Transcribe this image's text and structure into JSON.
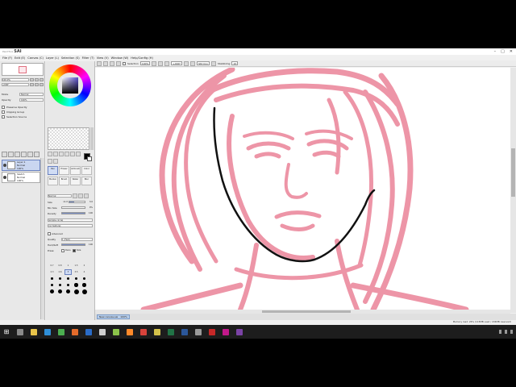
{
  "window": {
    "logo_small": "PaintTool",
    "logo": "SAI",
    "controls": [
      "–",
      "□",
      "✕"
    ]
  },
  "menu": [
    "File (F)",
    "Edit (E)",
    "Canvas (C)",
    "Layer (L)",
    "Selection (S)",
    "Filter (T)",
    "View (V)",
    "Window (W)",
    "Help/Config (H)"
  ],
  "toolbar": {
    "selection_label": "Selection",
    "zoom": "100%",
    "angle": "+000°",
    "stabilizer_label": "Stabilizing",
    "stabilizer_value": "10",
    "mode_label": "Std Cnv"
  },
  "navigator": {
    "zoom": "100.0%",
    "angle": "+000°"
  },
  "layer_props": {
    "opacity_label": "Opacity",
    "opacity_value": "100%",
    "blend_label": "Mode",
    "blend_value": "Normal",
    "preserve_label": "Preserve Opacity",
    "clip_label": "Clipping Group",
    "selection_source_label": "Selection Source"
  },
  "layers": [
    {
      "name": "Layer 1",
      "mode": "Normal",
      "opacity": "100%",
      "selected": true
    },
    {
      "name": "Sketch",
      "mode": "Normal",
      "opacity": "100%",
      "selected": false
    }
  ],
  "brush_tools": [
    {
      "label": "Pen",
      "selected": true
    },
    {
      "label": "Eraser",
      "selected": false
    },
    {
      "label": "Airbrush",
      "selected": false
    },
    {
      "label": "Color",
      "selected": false
    },
    {
      "label": "Marker",
      "selected": false
    },
    {
      "label": "Brush",
      "selected": false
    },
    {
      "label": "Water",
      "selected": false
    },
    {
      "label": "Blur",
      "selected": false
    }
  ],
  "brush_options": {
    "mode_label": "Normal",
    "size_label": "Size",
    "size_multiplier": "x1.0",
    "size_value": "3.0",
    "size_fraction": 0.3,
    "min_size_label": "Min Size",
    "min_size_value": "0%",
    "min_size_fraction": 0.0,
    "density_label": "Density",
    "density_value": "100",
    "density_fraction": 1.0,
    "shape_label": "(simple circle)",
    "texture_label": "(no texture)",
    "advanced_label": "Advanced",
    "quality_label": "Quality",
    "quality_value": "1 (Fast)",
    "hardness_label": "Hard/Soft",
    "hardness_value": "100",
    "pressure_label": "Press:",
    "pressure_items": [
      "Dens",
      "Size"
    ]
  },
  "brush_sizes": [
    [
      "0.7",
      "0.8",
      "1",
      "1.5",
      "2"
    ],
    [
      "2.3",
      "2.6",
      "3",
      "3.5",
      "4"
    ],
    [
      "5",
      "6",
      "7",
      "8",
      "9"
    ],
    [
      "10",
      "12",
      "14",
      "16",
      "20"
    ],
    [
      "25",
      "30",
      "35",
      "40",
      "50"
    ]
  ],
  "selected_brush_size": "3",
  "tab": {
    "name": "New canvas.sai",
    "zoom": "100%"
  },
  "status": {
    "memory": "Memory load: 26% (115MB used / 434MB reserved)"
  },
  "colors": {
    "sketch_pink": "#e8728a",
    "ink": "#111111",
    "selection_blue": "#c9d6f0"
  },
  "taskbar": {
    "icons": [
      {
        "name": "task-view-icon",
        "color": "#8a8a8a"
      },
      {
        "name": "folder-icon",
        "color": "#e8c44a"
      },
      {
        "name": "store-icon",
        "color": "#2f8fd8"
      },
      {
        "name": "chrome-icon",
        "color": "#4caf50"
      },
      {
        "name": "app-icon",
        "color": "#e36b2b"
      },
      {
        "name": "photoshop-icon",
        "color": "#2a6cc8"
      },
      {
        "name": "paint-tool-sai-icon",
        "color": "#cfcfcf"
      },
      {
        "name": "app-green-icon",
        "color": "#8bc34a"
      },
      {
        "name": "app-orange-icon",
        "color": "#ff8a2a"
      },
      {
        "name": "app-red-icon",
        "color": "#d8433b"
      },
      {
        "name": "app-yellow-icon",
        "color": "#d4c24a"
      },
      {
        "name": "excel-icon",
        "color": "#217346"
      },
      {
        "name": "word-icon",
        "color": "#2b579a"
      },
      {
        "name": "app-gray-icon",
        "color": "#9a9a9a"
      },
      {
        "name": "app-red2-icon",
        "color": "#c62828"
      },
      {
        "name": "app-magenta-icon",
        "color": "#c2188b"
      },
      {
        "name": "app-purple-icon",
        "color": "#7b43a6"
      }
    ]
  }
}
